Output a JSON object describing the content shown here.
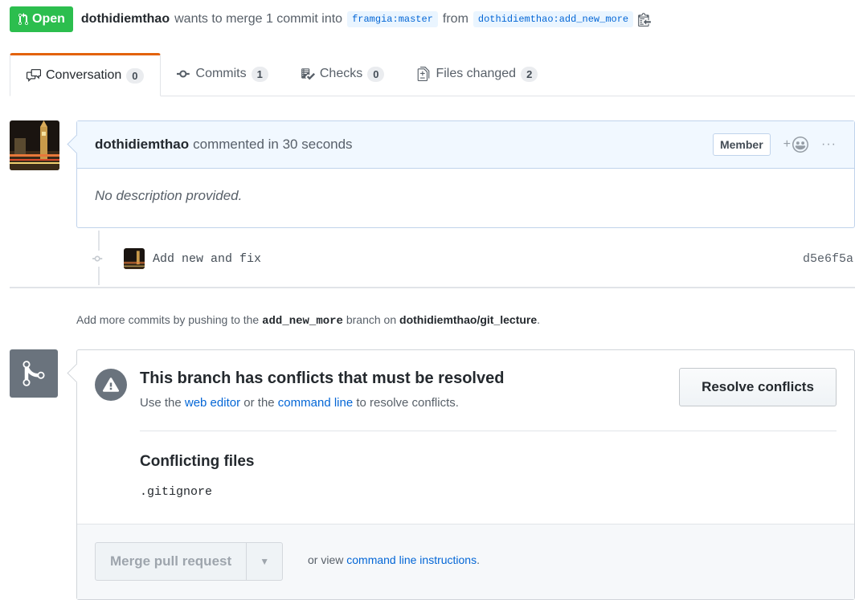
{
  "header": {
    "state_label": "Open",
    "author": "dothidiemthao",
    "action_text": "wants to merge 1 commit into",
    "base_branch": "framgia:master",
    "from_text": "from",
    "head_branch": "dothidiemthao:add_new_more"
  },
  "tabs": [
    {
      "label": "Conversation",
      "count": "0",
      "icon": "comment-discussion-icon"
    },
    {
      "label": "Commits",
      "count": "1",
      "icon": "git-commit-icon"
    },
    {
      "label": "Checks",
      "count": "0",
      "icon": "checklist-icon"
    },
    {
      "label": "Files changed",
      "count": "2",
      "icon": "file-diff-icon"
    }
  ],
  "comment": {
    "author": "dothidiemthao",
    "meta": "commented in 30 seconds",
    "role_badge": "Member",
    "reaction_plus": "+",
    "more": "···",
    "body": "No description provided."
  },
  "commit": {
    "message": "Add new and fix",
    "sha": "d5e6f5a"
  },
  "push_hint": {
    "prefix": "Add more commits by pushing to the",
    "branch": "add_new_more",
    "middle": "branch on",
    "repo": "dothidiemthao/git_lecture",
    "suffix": "."
  },
  "merge": {
    "title": "This branch has conflicts that must be resolved",
    "sub_prefix": "Use the",
    "web_editor": "web editor",
    "sub_or": "or the",
    "command_line": "command line",
    "sub_suffix": "to resolve conflicts.",
    "resolve_button": "Resolve conflicts",
    "conflicting_title": "Conflicting files",
    "files": [
      ".gitignore"
    ],
    "merge_button": "Merge pull request",
    "or_view": "or view",
    "cli_link": "command line instructions",
    "cli_suffix": "."
  },
  "colors": {
    "open_green": "#2cbe4e",
    "link_blue": "#0366d6",
    "tab_accent": "#e36209",
    "comment_header_bg": "#f1f8ff"
  }
}
